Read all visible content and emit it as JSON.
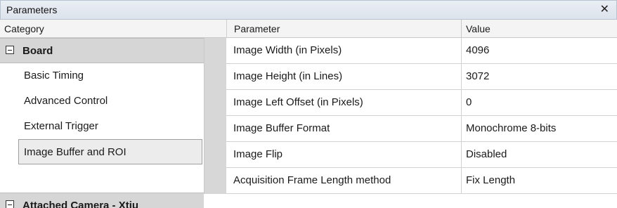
{
  "window": {
    "title": "Parameters",
    "close_glyph": "✕"
  },
  "headers": {
    "category": "Category",
    "parameter": "Parameter",
    "value": "Value"
  },
  "tree": {
    "board": {
      "label": "Board",
      "items": [
        "Basic Timing",
        "Advanced Control",
        "External Trigger",
        "Image Buffer and ROI"
      ],
      "selected_index": 3
    },
    "camera": {
      "label": "Attached Camera - Xtiu"
    }
  },
  "rows": [
    {
      "parameter": "Image Width (in Pixels)",
      "value": "4096"
    },
    {
      "parameter": "Image Height (in Lines)",
      "value": "3072"
    },
    {
      "parameter": "Image Left Offset (in Pixels)",
      "value": "0"
    },
    {
      "parameter": "Image Buffer Format",
      "value": "Monochrome 8-bits"
    },
    {
      "parameter": "Image Flip",
      "value": "Disabled"
    },
    {
      "parameter": "Acquisition Frame Length method",
      "value": "Fix Length"
    }
  ]
}
